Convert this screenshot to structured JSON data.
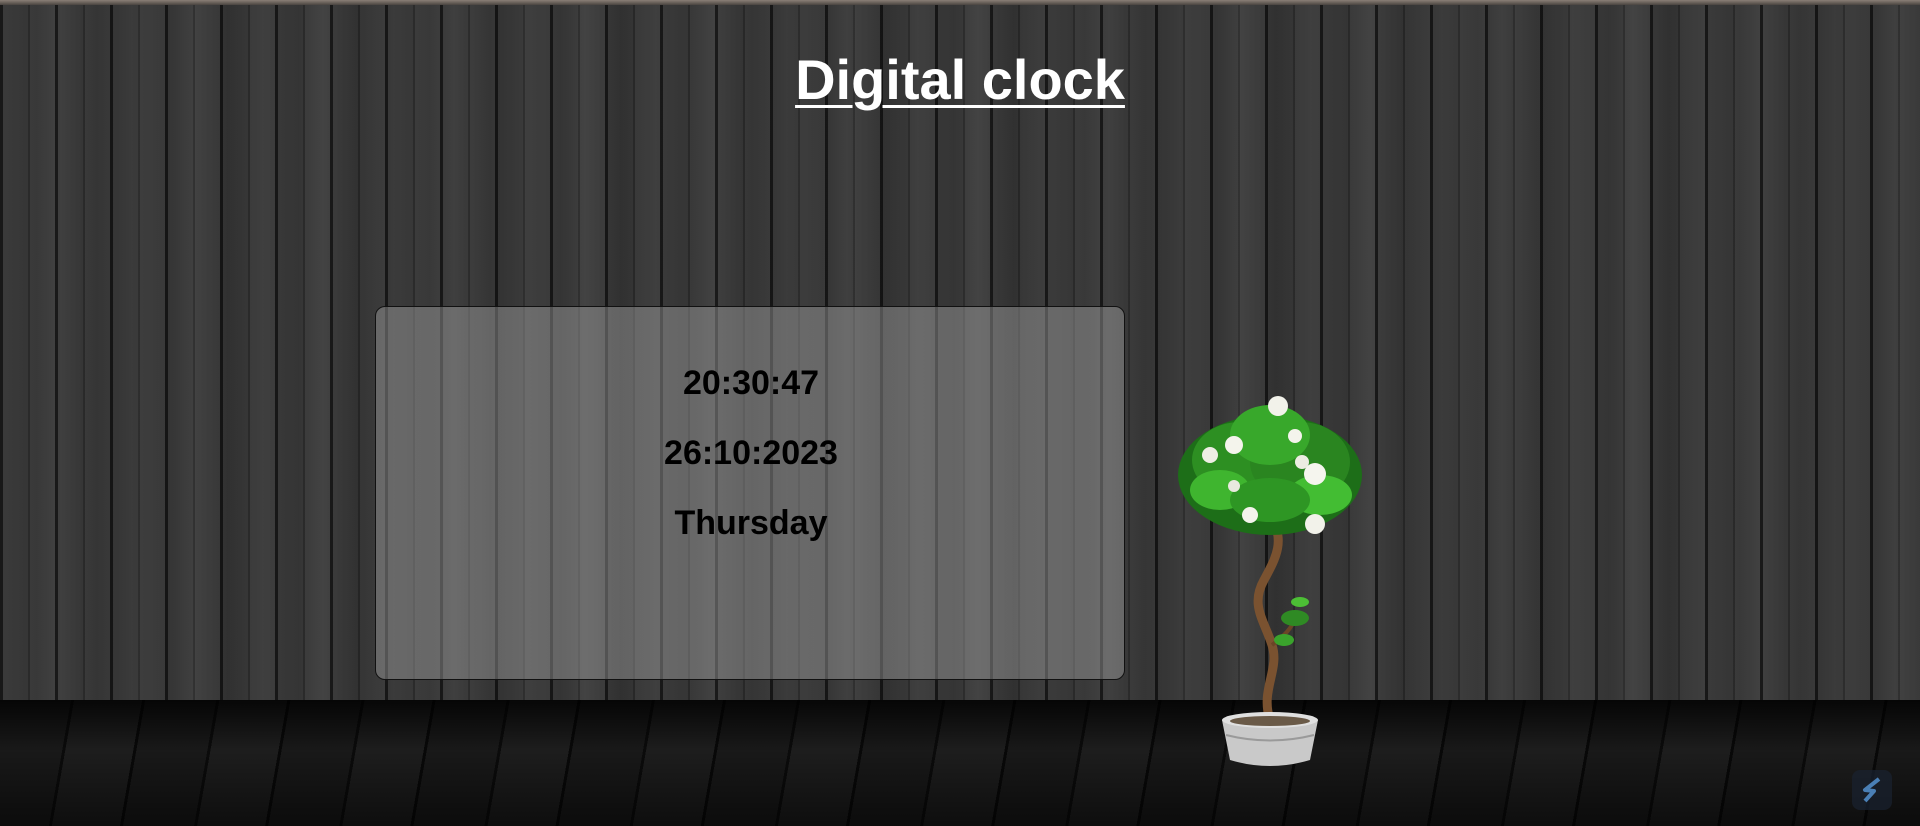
{
  "page": {
    "title": "Digital clock"
  },
  "clock": {
    "time": "20:30:47",
    "date": "26:10:2023",
    "day": "Thursday"
  },
  "colors": {
    "title_text": "#ffffff",
    "clock_text": "#000000",
    "panel_background": "rgba(170,170,170,0.42)",
    "wall": "#2c2c2c"
  },
  "icons": {
    "decoration": "potted-tree-icon",
    "badge": "s-logo-icon"
  }
}
